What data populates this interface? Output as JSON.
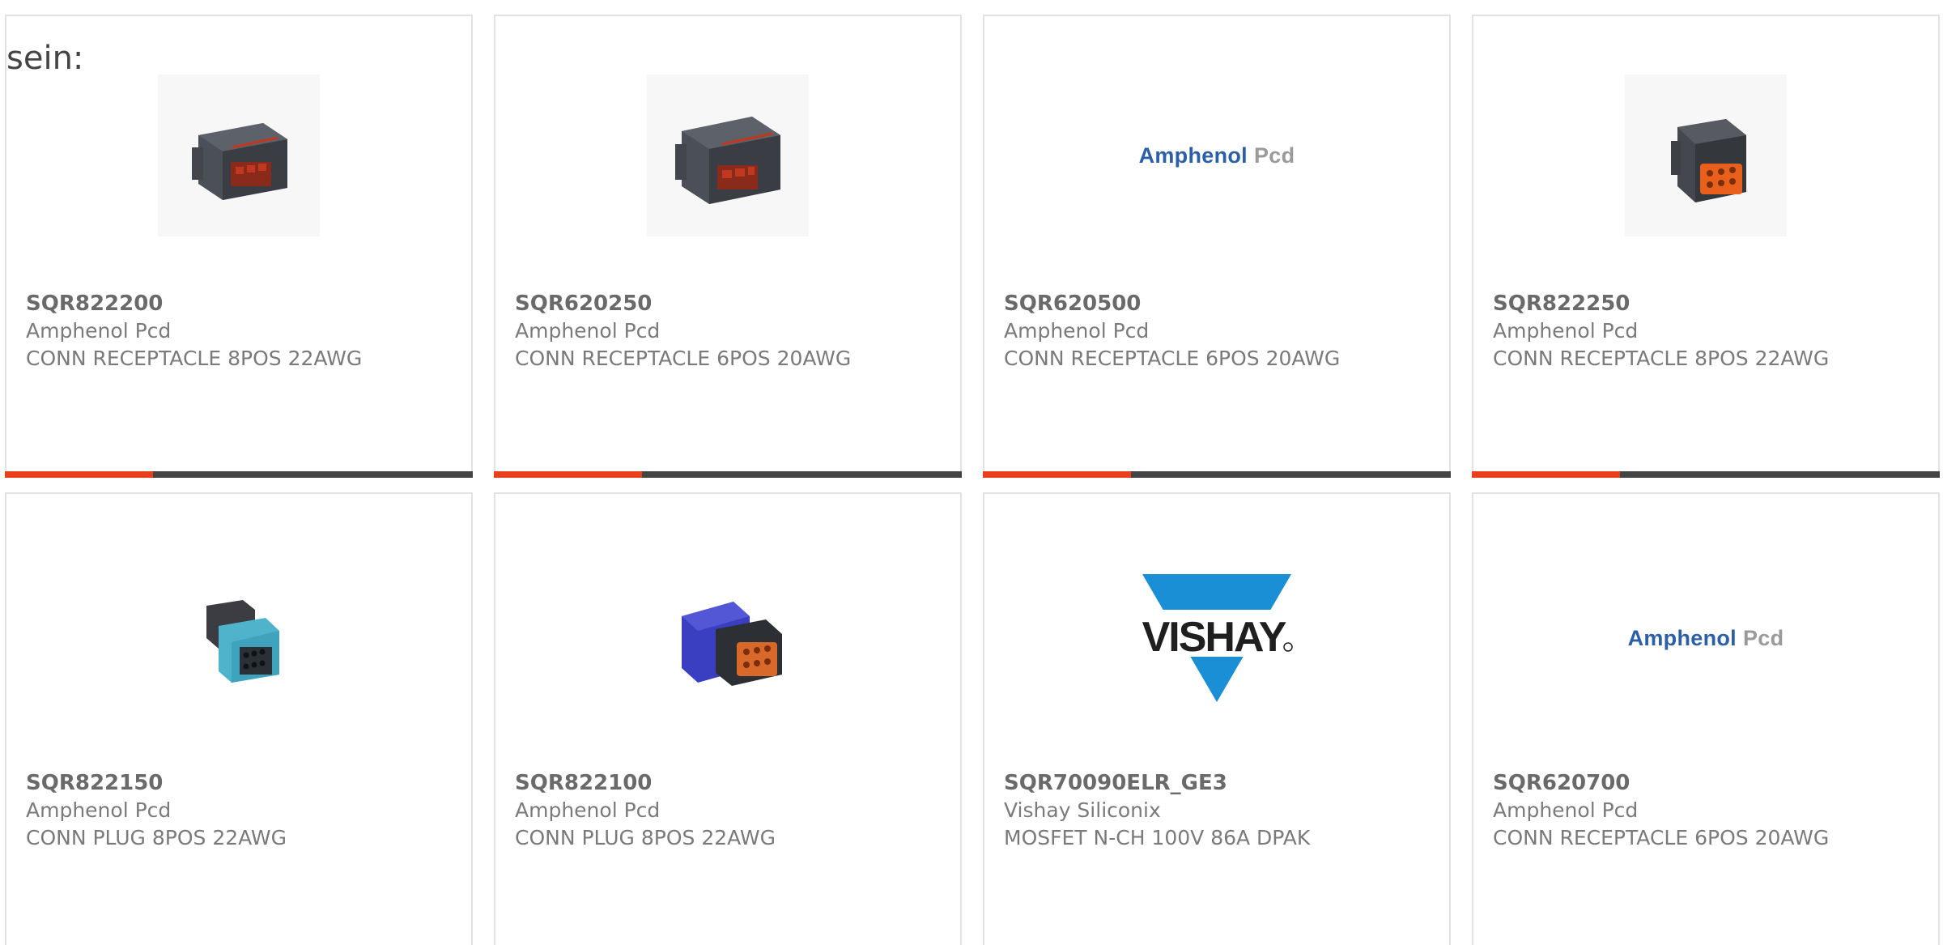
{
  "page": {
    "intro_text": "sein:"
  },
  "colors": {
    "accent": "#e8401c",
    "bar_dark": "#444444",
    "amphenol_blue": "#2b5fa8",
    "pcd_gray": "#9a9a9a",
    "vishay_blue": "#1a8fd6"
  },
  "products": [
    {
      "part_number": "SQR822200",
      "manufacturer": "Amphenol Pcd",
      "description": "CONN RECEPTACLE 8POS 22AWG",
      "image": "connector-receptacle-gray-red"
    },
    {
      "part_number": "SQR620250",
      "manufacturer": "Amphenol Pcd",
      "description": "CONN RECEPTACLE 6POS 20AWG",
      "image": "connector-receptacle-gray-red"
    },
    {
      "part_number": "SQR620500",
      "manufacturer": "Amphenol Pcd",
      "description": "CONN RECEPTACLE 6POS 20AWG",
      "image": "amphenol-pcd-logo",
      "logo_words": [
        "Amphenol",
        "Pcd"
      ]
    },
    {
      "part_number": "SQR822250",
      "manufacturer": "Amphenol Pcd",
      "description": "CONN RECEPTACLE 8POS 22AWG",
      "image": "connector-receptacle-gray-orange"
    },
    {
      "part_number": "SQR822150",
      "manufacturer": "Amphenol Pcd",
      "description": "CONN PLUG 8POS 22AWG",
      "image": "connector-plug-teal"
    },
    {
      "part_number": "SQR822100",
      "manufacturer": "Amphenol Pcd",
      "description": "CONN PLUG 8POS 22AWG",
      "image": "connector-plug-blue-orange"
    },
    {
      "part_number": "SQR70090ELR_GE3",
      "manufacturer": "Vishay Siliconix",
      "description": "MOSFET N-CH 100V 86A DPAK",
      "image": "vishay-logo",
      "logo_words": [
        "VISHAY"
      ]
    },
    {
      "part_number": "SQR620700",
      "manufacturer": "Amphenol Pcd",
      "description": "CONN RECEPTACLE 6POS 20AWG",
      "image": "amphenol-pcd-logo",
      "logo_words": [
        "Amphenol",
        "Pcd"
      ]
    }
  ]
}
